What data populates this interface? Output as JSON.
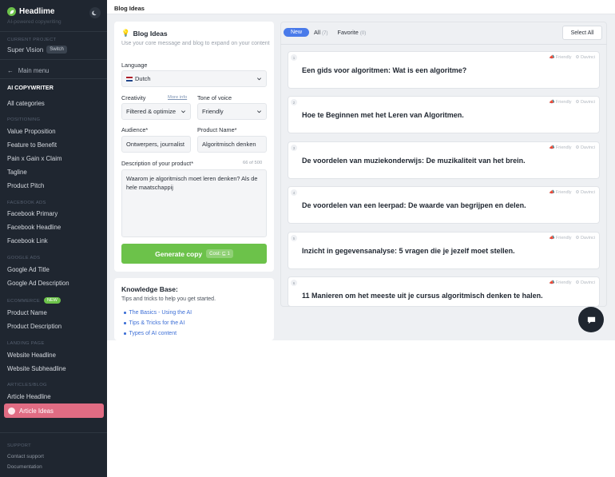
{
  "sidebar": {
    "brand": "Headlime",
    "tagline": "AI-powered copywriting",
    "current_project_label": "CURRENT PROJECT",
    "project_name": "Super Vision",
    "switch_label": "Switch",
    "main_menu": "Main menu",
    "ai_copywriter": "AI COPYWRITER",
    "all_categories": "All categories",
    "positioning_label": "POSITIONING",
    "positioning_items": [
      "Value Proposition",
      "Feature to Benefit",
      "Pain x Gain x Claim",
      "Tagline",
      "Product Pitch"
    ],
    "facebook_label": "FACEBOOK ADS",
    "facebook_items": [
      "Facebook Primary",
      "Facebook Headline",
      "Facebook Link"
    ],
    "google_label": "GOOGLE ADS",
    "google_items": [
      "Google Ad Title",
      "Google Ad Description"
    ],
    "ecommerce_label": "ECOMMERCE",
    "ecommerce_badge": "NEW",
    "ecommerce_items": [
      "Product Name",
      "Product Description"
    ],
    "landing_label": "LANDING PAGE",
    "landing_items": [
      "Website Headline",
      "Website Subheadline"
    ],
    "articles_label": "ARTICLES/BLOG",
    "articles_items": [
      "Article Headline"
    ],
    "active_item": "Article Ideas",
    "support_label": "SUPPORT",
    "support_items": [
      "Contact support",
      "Documentation"
    ]
  },
  "header": {
    "title": "Blog Ideas"
  },
  "form": {
    "title": "Blog Ideas",
    "subtitle": "Use your core message and blog to expand on your content",
    "language_label": "Language",
    "language_value": "Dutch",
    "creativity_label": "Creativity",
    "more_info": "More info",
    "creativity_value": "Filtered & optimize",
    "tone_label": "Tone of voice",
    "tone_value": "Friendly",
    "audience_label": "Audience*",
    "audience_value": "Ontwerpers, journalist",
    "product_label": "Product Name*",
    "product_value": "Algoritmisch denken",
    "description_label": "Description of your product*",
    "char_count": "66 of 500",
    "description_value": "Waarom je algoritmisch moet leren denken? Als de hele maatschappij",
    "generate_label": "Generate copy",
    "cost_label": "Cost: ⊑ 1"
  },
  "knowledge_base": {
    "title": "Knowledge Base:",
    "subtitle": "Tips and tricks to help you get started.",
    "links": [
      "The Basics - Using the AI",
      "Tips & Tricks for the AI",
      "Types of AI content"
    ]
  },
  "results": {
    "tabs": {
      "new": "New",
      "all": "All",
      "all_count": "(7)",
      "favorite": "Favorite",
      "favorite_count": "(0)"
    },
    "select_all": "Select All",
    "meta_tone": "Friendly",
    "meta_engine": "Davinci",
    "ideas": [
      {
        "num": "1",
        "text": "Een gids voor algoritmen: Wat is een algoritme?"
      },
      {
        "num": "2",
        "text": "Hoe te Beginnen met het Leren van Algoritmen."
      },
      {
        "num": "3",
        "text": "De voordelen van muziekonderwijs: De muzikaliteit van het brein."
      },
      {
        "num": "4",
        "text": "De voordelen van een leerpad: De waarde van begrijpen en delen."
      },
      {
        "num": "5",
        "text": "Inzicht in gegevensanalyse: 5 vragen die je jezelf moet stellen."
      },
      {
        "num": "6",
        "text": "11 Manieren om het meeste uit je cursus algoritmisch denken te halen."
      }
    ]
  },
  "colors": {
    "sidebar_bg": "#1f2630",
    "accent_green": "#6cc24a",
    "active_pink": "#e06c83",
    "tab_blue": "#4a7bea"
  }
}
